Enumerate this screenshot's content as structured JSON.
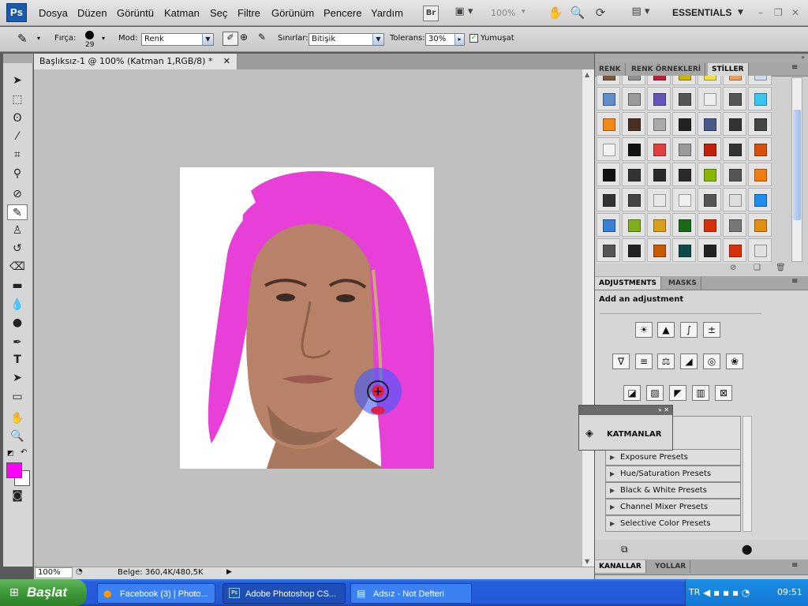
{
  "app": {
    "logo": "Ps"
  },
  "menu": [
    "Dosya",
    "Düzen",
    "Görüntü",
    "Katman",
    "Seç",
    "Filtre",
    "Görünüm",
    "Pencere",
    "Yardım"
  ],
  "appbar": {
    "bridge": "Br",
    "zoom": "100%",
    "workspace": "ESSENTIALS"
  },
  "options": {
    "brush_label": "Fırça:",
    "brush_size": "29",
    "mode_label": "Mod:",
    "mode_value": "Renk",
    "limits_label": "Sınırlar:",
    "limits_value": "Bitişik",
    "tolerance_label": "Tolerans:",
    "tolerance_value": "30%",
    "antialias_label": "Yumuşat",
    "antialias_checked": true
  },
  "document": {
    "tab_title": "Başlıksız-1 @ 100% (Katman 1,RGB/8) *"
  },
  "status": {
    "zoom": "100%",
    "doc_size": "Belge: 360,4K/480,5K"
  },
  "colors": {
    "foreground": "#ff00ff",
    "background": "#ffffff",
    "hair": "#e83fd8"
  },
  "panels": {
    "swatch_tabs": [
      "RENK",
      "RENK ÖRNEKLERİ",
      "STİLLER"
    ],
    "adjust_tabs": [
      "ADJUSTMENTS",
      "MASKS"
    ],
    "add_adjustment": "Add an adjustment",
    "presets": [
      "Exposure Presets",
      "Hue/Saturation Presets",
      "Black & White Presets",
      "Channel Mixer Presets",
      "Selective Color Presets"
    ],
    "layers_label": "KATMANLAR",
    "bottom_tabs": [
      "KANALLAR",
      "YOLLAR"
    ]
  },
  "taskbar": {
    "start": "Başlat",
    "tasks": [
      "Facebook (3) | Photo...",
      "Adobe Photoshop CS...",
      "Adsız - Not Defteri"
    ],
    "lang": "TR",
    "clock": "09:51"
  }
}
